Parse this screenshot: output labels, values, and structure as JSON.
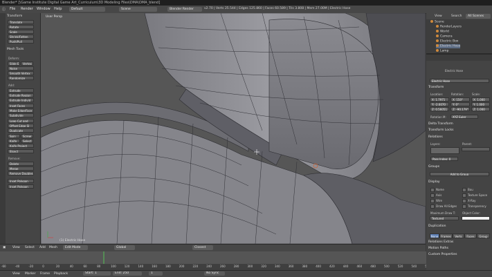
{
  "window": {
    "title": "Blender* [\\Game Institute Digital Game Art_Curriculum\\3D Modeling Files\\DMA\\DMA_blend]"
  },
  "topbar": {
    "menus": [
      "File",
      "Render",
      "Window",
      "Help"
    ],
    "layout": "Default",
    "scene": "Scene",
    "engine": "Blender Render",
    "stats": "v2.70 | Verts 25.544 | Edges 125.860 | Faces 60.589 | Tris 3.808 | Mem 27.00M | Electric Hose"
  },
  "toolshelf": {
    "transform_header": "Transform",
    "transform": [
      "Translate",
      "Rotate",
      "Scale",
      "Shrink/Fatten",
      "Push/Pull"
    ],
    "mesh_header": "Mesh Tools",
    "deform_label": "Deform:",
    "deform": [
      "Slide E",
      "Vertex",
      "Noise",
      "Smooth Vertex",
      "Randomize"
    ],
    "add_label": "Add:",
    "add": [
      "Extrude",
      "Extrude Region",
      "Extrude Individ",
      "Inset Faces",
      "Make Edge/Face",
      "Subdivide",
      "Loop Cut and",
      "Offset Edge Sl",
      "Duplicate",
      "Spin",
      "Screw",
      "Knife",
      "Select",
      "Knife Project",
      "Bisect"
    ],
    "remove_label": "Remove:",
    "remove": [
      "Delete",
      "Merge",
      "Remove Doubles",
      "Inset Polygon",
      "Inset Polygon"
    ]
  },
  "viewport": {
    "view_label": "User Persp",
    "object_label": "(1) Electric Hose"
  },
  "view3d_header": {
    "menus": [
      "View",
      "Select",
      "Add",
      "Mesh"
    ],
    "mode": "Edit Mode",
    "pivot": "Global",
    "snap": "Closest"
  },
  "timeline": {
    "ticks": [
      "-60",
      "-40",
      "-20",
      "0",
      "20",
      "40",
      "60",
      "80",
      "100",
      "120",
      "140",
      "160",
      "180",
      "200",
      "220",
      "240",
      "260",
      "280",
      "300",
      "320",
      "340",
      "360",
      "380",
      "400",
      "420",
      "440",
      "460",
      "480",
      "500",
      "520",
      "540",
      "560",
      "580",
      "600",
      "620",
      "640"
    ],
    "menus": [
      "View",
      "Marker",
      "Frame",
      "Playback"
    ],
    "start": "Start: 1",
    "end": "End: 250",
    "current": "1",
    "sync": "No Sync"
  },
  "outliner": {
    "header": [
      "View",
      "Search",
      "All Scenes"
    ],
    "items": [
      "Scene",
      "RenderLayers",
      "World",
      "Camera",
      "Electric Box",
      "Electric Hose",
      "Lamp"
    ]
  },
  "properties": {
    "object_name": "Electric Hose",
    "breadcrumb": "Electric Hose",
    "transform_header": "Transform",
    "location_label": "Location:",
    "rotation_label": "Rotation:",
    "scale_label": "Scale:",
    "location": [
      "X: 1.7971",
      "Y: -2.6070",
      "Z: 0.56051"
    ],
    "rotation": [
      "X: 150°",
      "Y: 0°",
      "Z: -90.179°"
    ],
    "scale": [
      "X: 1.000",
      "Y: 1.000",
      "Z: 1.000"
    ],
    "rotation_mode_label": "Rotation M:",
    "rotation_mode": "XYZ Euler",
    "delta_header": "Delta Transform",
    "locks_header": "Transform Locks",
    "relations_header": "Relations",
    "layers_label": "Layers:",
    "parent_label": "Parent:",
    "pass_index": "Pass Index: 0",
    "groups_header": "Groups",
    "add_to_group": "Add to Group",
    "display_header": "Display",
    "display_checks": [
      "Name",
      "Bou",
      "Axis",
      "Texture Space",
      "Wire",
      "X-Ray",
      "Draw All Edges",
      "Transparency"
    ],
    "max_draw_label": "Maximum Draw T:",
    "object_color_label": "Object Color:",
    "max_draw": "Textured",
    "duplication_header": "Duplication",
    "dup_tabs": [
      "None",
      "Frames",
      "Verts",
      "Faces",
      "Group"
    ],
    "extra_headers": [
      "Relations Extras",
      "Motion Paths",
      "Custom Properties"
    ]
  }
}
